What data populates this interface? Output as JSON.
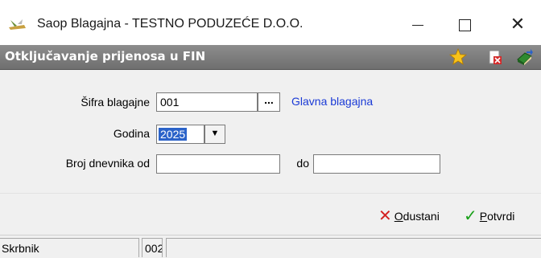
{
  "window": {
    "title": "Saop Blagajna - TESTNO PODUZEĆE D.O.O.",
    "controls": {
      "minimize": "minimize-icon",
      "maximize": "maximize-icon",
      "close": "close-icon"
    },
    "close_glyph": "✕"
  },
  "header": {
    "title": "Otključavanje prijenosa u FIN",
    "icons": [
      "star-icon",
      "close-document-icon",
      "book-exit-icon"
    ]
  },
  "form": {
    "sifra": {
      "label": "Šifra blagajne",
      "value": "001",
      "browse_label": "...",
      "name_text": "Glavna blagajna"
    },
    "godina": {
      "label": "Godina",
      "value": "2025",
      "dropdown_glyph": "▼"
    },
    "broj_dnevnika": {
      "label": "Broj dnevnika od",
      "od_value": "",
      "do_label": "do",
      "do_value": ""
    }
  },
  "actions": {
    "cancel": {
      "label_first": "O",
      "label_rest": "dustani",
      "glyph": "✕"
    },
    "confirm": {
      "label_first": "P",
      "label_rest": "otvrdi",
      "glyph": "✓"
    }
  },
  "statusbar": {
    "user": "Skrbnik",
    "code": "002",
    "extra": ""
  },
  "colors": {
    "header_band": "#7f7f7f",
    "link": "#1a3ad6",
    "selection": "#2b63c9",
    "cancel": "#d42020",
    "confirm": "#18a018"
  }
}
